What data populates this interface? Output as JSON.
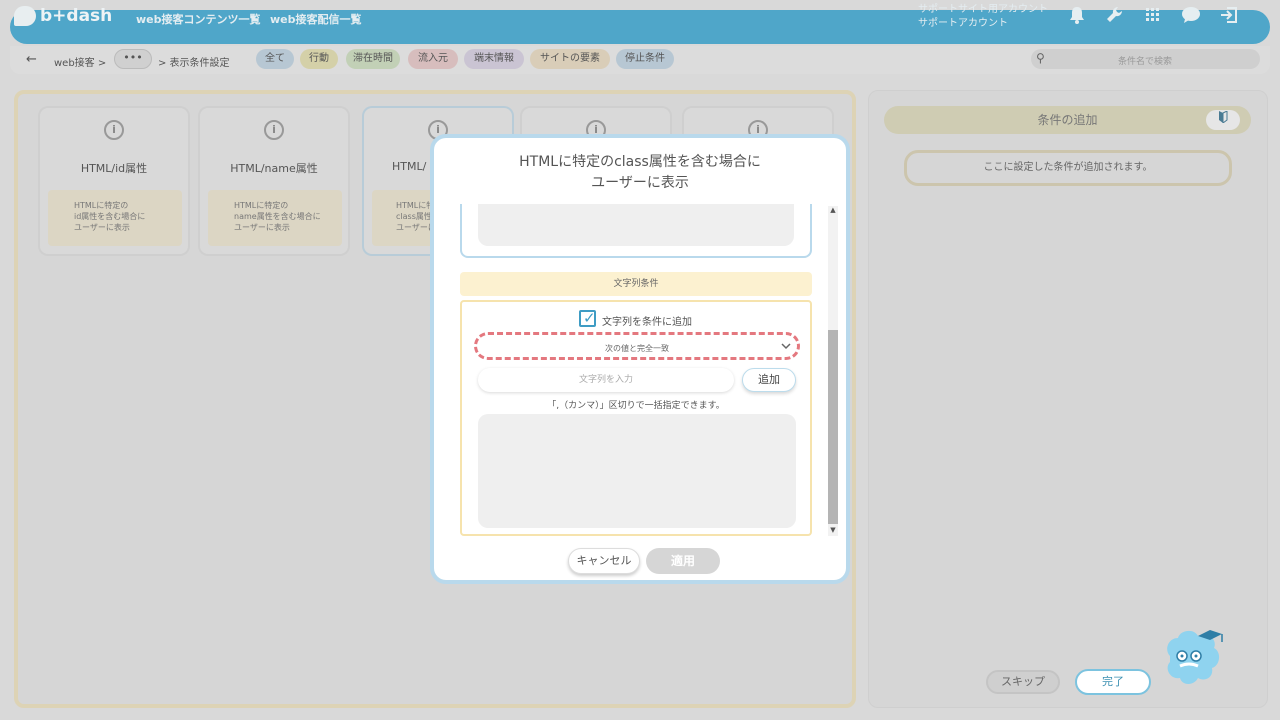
{
  "header": {
    "logo_text": "b+dash",
    "nav": [
      "web接客コンテンツ一覧",
      "web接客配信一覧"
    ],
    "account_line1": "サポートサイト用アカウント",
    "account_line2": "サポートアカウント",
    "icons": [
      "bell-icon",
      "wrench-icon",
      "grid-icon",
      "chat-icon",
      "logout-icon"
    ]
  },
  "breadcrumb": {
    "back": "←",
    "root": "web接客 >",
    "more": "•••",
    "current": "> 表示条件設定"
  },
  "filter_chips": [
    {
      "label": "全て",
      "color": "#b7c7d3"
    },
    {
      "label": "行動",
      "color": "#d4d0a8"
    },
    {
      "label": "滞在時間",
      "color": "#c2d0b6"
    },
    {
      "label": "流入元",
      "color": "#d7bdbd"
    },
    {
      "label": "端末情報",
      "color": "#cac4d3"
    },
    {
      "label": "サイトの要素",
      "color": "#d9cdb8"
    },
    {
      "label": "停止条件",
      "color": "#b7c7d3"
    }
  ],
  "search": {
    "placeholder": "条件名で検索"
  },
  "cards": [
    {
      "title": "HTML/id属性",
      "desc": "HTMLに特定の\nid属性を含む場合に\nユーザーに表示"
    },
    {
      "title": "HTML/name属性",
      "desc": "HTMLに特定の\nname属性を含む場合に\nユーザーに表示"
    },
    {
      "title": "HTML/",
      "desc": "HTMLに特\nclass属性\nユーザーに"
    },
    {
      "title": "",
      "desc": ""
    },
    {
      "title": "",
      "desc": ""
    }
  ],
  "right_panel": {
    "add_condition": "条件の追加",
    "placeholder": "ここに設定した条件が追加されます。",
    "skip": "スキップ",
    "done": "完了"
  },
  "modal": {
    "title_line1": "HTMLに特定のclass属性を含む場合に",
    "title_line2": "ユーザーに表示",
    "section_title": "文字列条件",
    "checkbox_label": "文字列を条件に追加",
    "checkbox_checked": true,
    "match_select": "次の値と完全一致",
    "input_placeholder": "文字列を入力",
    "add_button": "追加",
    "hint": "「,（カンマ）」区切りで一括指定できます。",
    "cancel": "キャンセル",
    "apply": "適用"
  }
}
